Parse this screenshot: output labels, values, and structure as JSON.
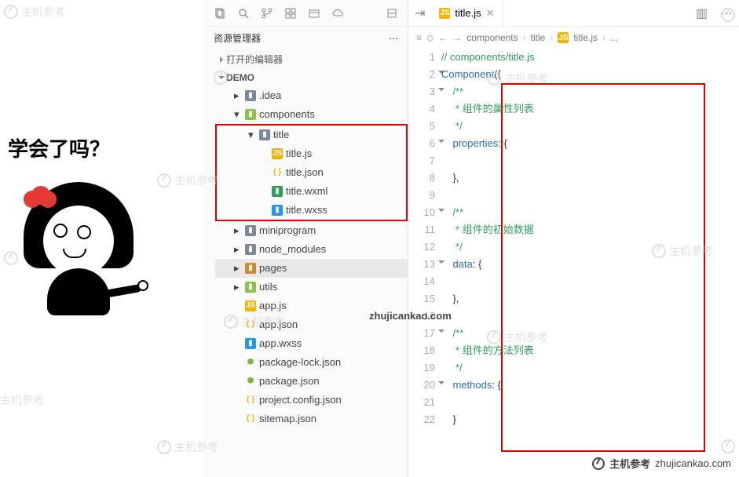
{
  "meme": {
    "caption": "学会了吗？"
  },
  "toolbar": {},
  "explorer": {
    "title": "资源管理器",
    "open_editors": "打开的编辑器",
    "root": "DEMO",
    "tree": {
      "idea": ".idea",
      "components": "components",
      "title_folder": "title",
      "title_js": "title.js",
      "title_json": "title.json",
      "title_wxml": "title.wxml",
      "title_wxss": "title.wxss",
      "miniprogram": "miniprogram",
      "node_modules": "node_modules",
      "pages": "pages",
      "utils": "utils",
      "app_js": "app.js",
      "app_json": "app.json",
      "app_wxss": "app.wxss",
      "pkg_lock": "package-lock.json",
      "pkg": "package.json",
      "proj_cfg": "project.config.json",
      "sitemap": "sitemap.json"
    }
  },
  "editor": {
    "tab": {
      "name": "title.js"
    },
    "breadcrumb": {
      "p1": "components",
      "p2": "title",
      "p3": "title.js",
      "p4": "..."
    },
    "lines": [
      {
        "n": 1,
        "t": "// components/title.js",
        "cls": "c-comment"
      },
      {
        "n": 2,
        "t": "Component({",
        "key": "Component",
        "rest": "({",
        "fold": true
      },
      {
        "n": 3,
        "t": "    /**",
        "cls": "c-doc",
        "fold": true
      },
      {
        "n": 4,
        "t": "     * 组件的属性列表",
        "cls": "c-doc"
      },
      {
        "n": 5,
        "t": "     */",
        "cls": "c-doc"
      },
      {
        "n": 6,
        "t": "    properties: {",
        "prop": "properties",
        "rest": ": {",
        "fold": true
      },
      {
        "n": 7,
        "t": ""
      },
      {
        "n": 8,
        "t": "    },"
      },
      {
        "n": 9,
        "t": ""
      },
      {
        "n": 10,
        "t": "    /**",
        "cls": "c-doc",
        "fold": true
      },
      {
        "n": 11,
        "t": "     * 组件的初始数据",
        "cls": "c-doc"
      },
      {
        "n": 12,
        "t": "     */",
        "cls": "c-doc"
      },
      {
        "n": 13,
        "t": "    data: {",
        "prop": "data",
        "rest": ": {",
        "fold": true
      },
      {
        "n": 14,
        "t": ""
      },
      {
        "n": 15,
        "t": "    },"
      },
      {
        "n": 16,
        "t": ""
      },
      {
        "n": 17,
        "t": "    /**",
        "cls": "c-doc",
        "fold": true
      },
      {
        "n": 18,
        "t": "     * 组件的方法列表",
        "cls": "c-doc"
      },
      {
        "n": 19,
        "t": "     */",
        "cls": "c-doc"
      },
      {
        "n": 20,
        "t": "    methods: {",
        "prop": "methods",
        "rest": ": {",
        "fold": true
      },
      {
        "n": 21,
        "t": ""
      },
      {
        "n": 22,
        "t": "    }"
      }
    ]
  },
  "watermarks": {
    "brand": "主机参考",
    "domain": "zhujicankao.com",
    "center": "zhujicankao.com"
  }
}
